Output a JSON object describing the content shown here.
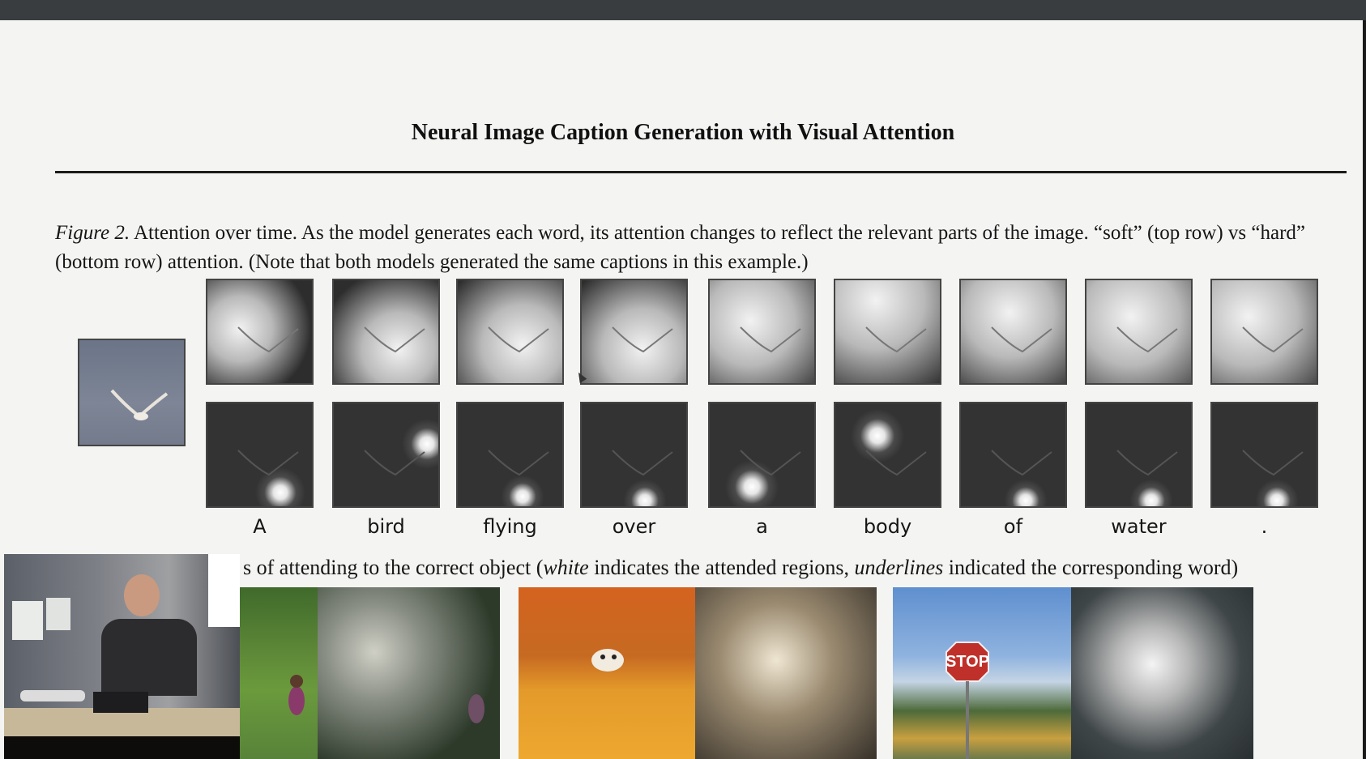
{
  "paper": {
    "header_title": "Neural Image Caption Generation with Visual Attention",
    "figure_label": "Figure 2.",
    "figure_caption": " Attention over time.  As the model generates each word, its attention changes to reflect the relevant parts of the image. “soft” (top row) vs “hard” (bottom row) attention. (Note that both models generated the same captions in this example.)"
  },
  "figure": {
    "rows": [
      "soft",
      "hard"
    ],
    "words": [
      "A",
      "bird",
      "flying",
      "over",
      "a",
      "body",
      "of",
      "water",
      "."
    ]
  },
  "bottom_caption": {
    "part1": "s of attending to the correct object (",
    "white": "white",
    "part2": " indicates the attended regions, ",
    "underlines": "underlines",
    "part3": " indicated the corresponding word)"
  },
  "photos": {
    "stop_sign_text": "STOP"
  }
}
